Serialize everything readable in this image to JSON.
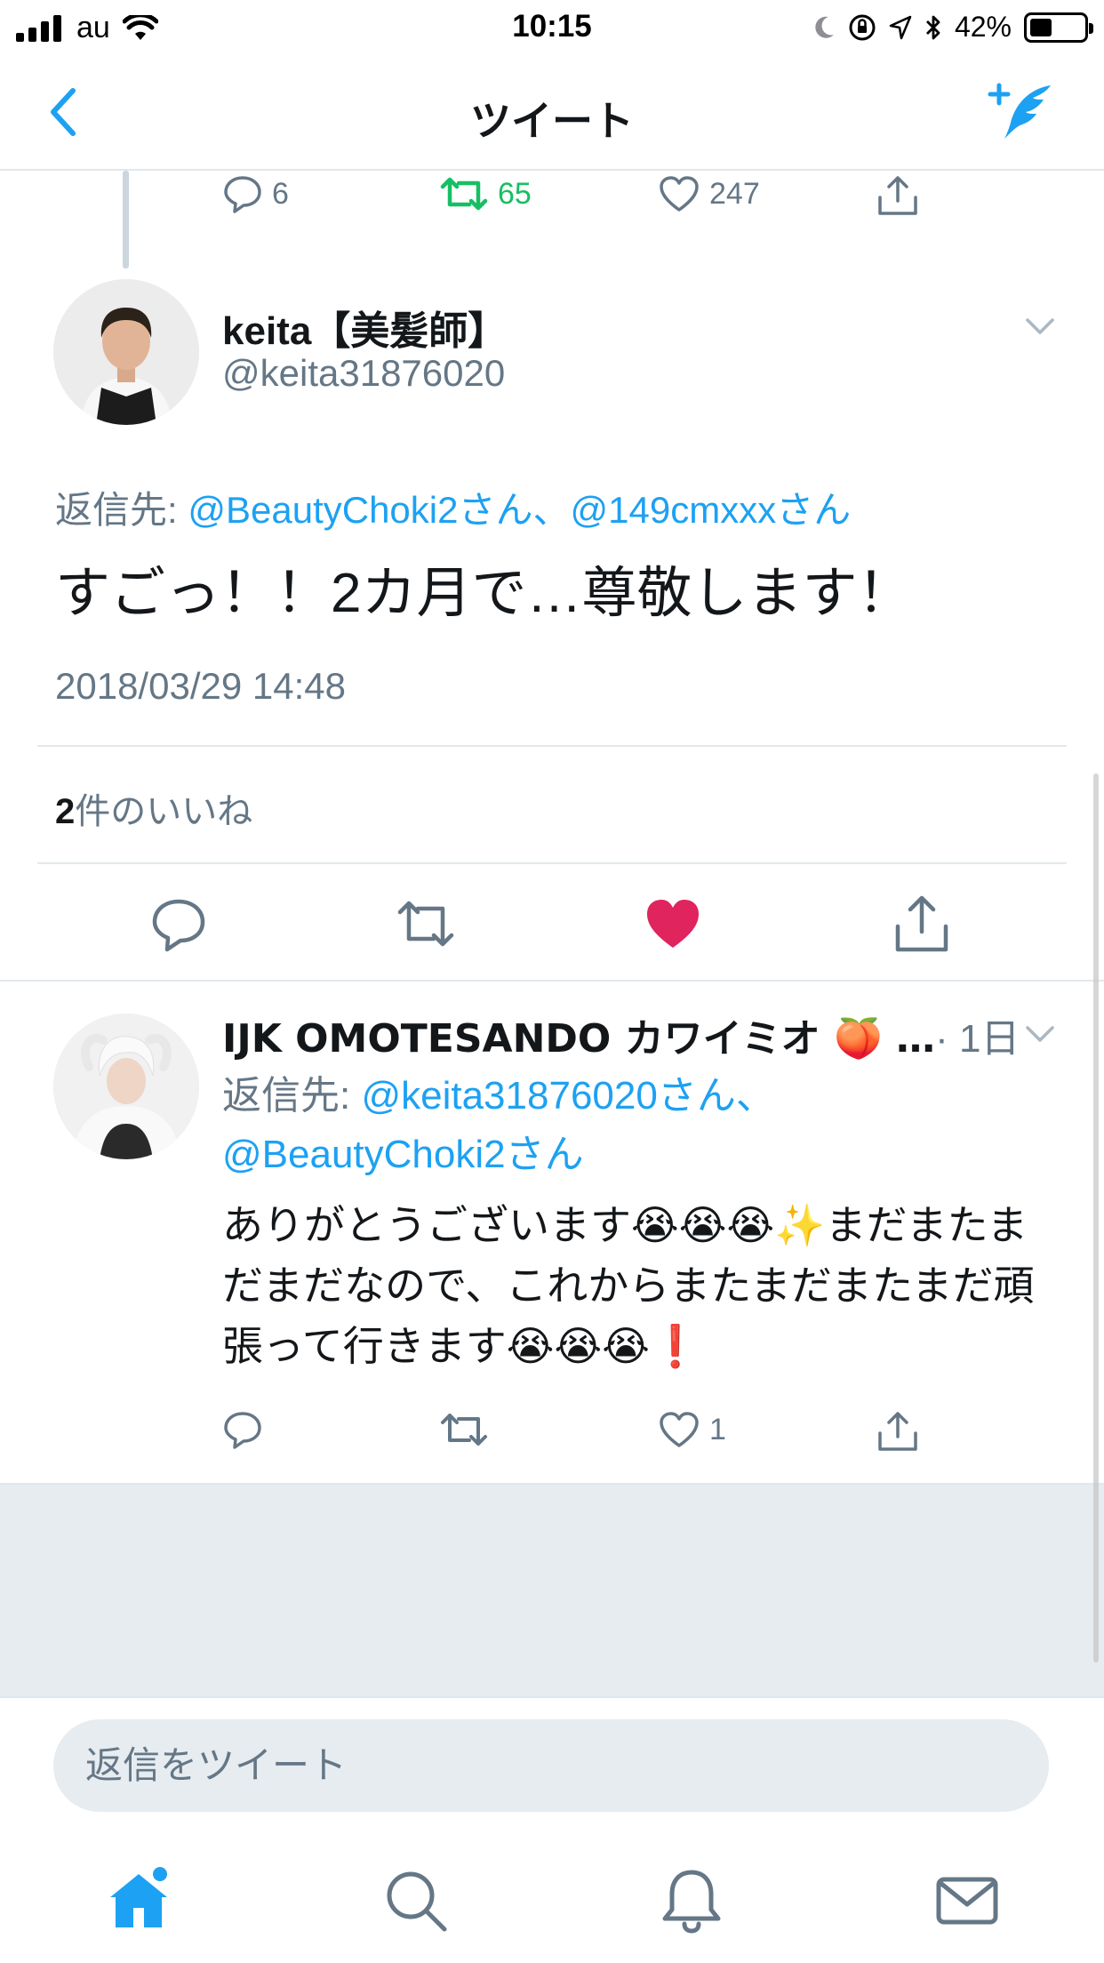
{
  "status_bar": {
    "carrier": "au",
    "time": "10:15",
    "battery": "42%",
    "battery_level": 0.42
  },
  "nav": {
    "title": "ツイート",
    "back_icon": "chevron-left-icon",
    "compose_icon": "compose-tweet-icon"
  },
  "previous_tweet_actions": {
    "replies": "6",
    "retweets": "65",
    "likes": "247"
  },
  "main_tweet": {
    "name": "keita【美髪師】",
    "handle": "@keita31876020",
    "reply_to_label": "返信先: ",
    "reply_to_1": "@BeautyChoki2さん",
    "reply_to_sep": "、",
    "reply_to_2": "@149cmxxxさん",
    "text": "すごっ！！2カ月で…尊敬します！",
    "timestamp": "2018/03/29 14:48",
    "likes_count": "2",
    "likes_label": "件のいいね",
    "liked": true
  },
  "reply_tweet": {
    "name": "IJK OMOTESANDO カワイミオ 🍑 …",
    "time": "· 1日",
    "reply_to_label": "返信先: ",
    "reply_to_1": "@keita31876020さん、",
    "reply_to_2": "@BeautyChoki2さん",
    "text": "ありがとうございます😭😭😭✨まだまたまだまだなので、これからまたまだまたまだ頑張って行きます😭😭😭❗",
    "likes": "1"
  },
  "composer": {
    "placeholder": "返信をツイート"
  },
  "tabs": [
    "home-icon",
    "search-icon",
    "notifications-icon",
    "messages-icon"
  ],
  "colors": {
    "accent": "#1da1f2",
    "retweet": "#17bf63",
    "like": "#e0245e",
    "secondary_text": "#657786"
  }
}
